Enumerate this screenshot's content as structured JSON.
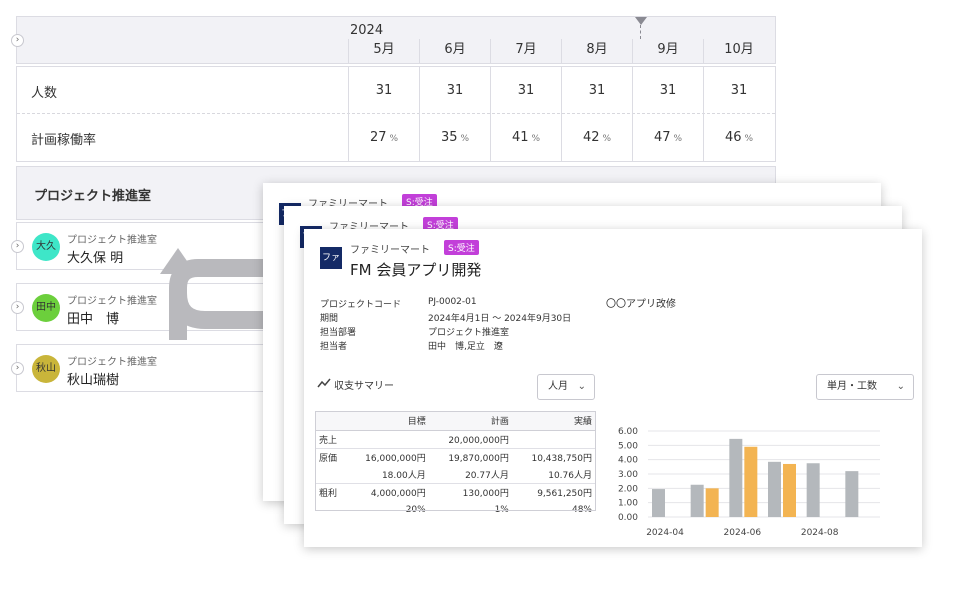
{
  "planner": {
    "year": "2024",
    "months": [
      "5月",
      "6月",
      "7月",
      "8月",
      "9月",
      "10月"
    ],
    "rows": [
      {
        "label": "人数",
        "values": [
          "31",
          "31",
          "31",
          "31",
          "31",
          "31"
        ]
      },
      {
        "label": "計画稼働率",
        "values": [
          "27",
          "35",
          "41",
          "42",
          "47",
          "46"
        ],
        "unit": "%"
      }
    ],
    "department": "プロジェクト推進室",
    "people": [
      {
        "avatar": "大久",
        "dept": "プロジェクト推進室",
        "name": "大久保 明",
        "color": "#3ee6c8"
      },
      {
        "avatar": "田中",
        "dept": "プロジェクト推進室",
        "name": "田中　博",
        "color": "#6ccf3c"
      },
      {
        "avatar": "秋山",
        "dept": "プロジェクト推進室",
        "name": "秋山瑞樹",
        "color": "#c9b53a"
      }
    ]
  },
  "cards": {
    "client": "ファミリーマート",
    "badge": "S:受注",
    "logo": "ファ",
    "title": "FM 会員アプリ開発",
    "info": [
      {
        "label": "プロジェクトコード",
        "value": "PJ-0002-01"
      },
      {
        "label": "期間",
        "value": "2024年4月1日 〜 2024年9月30日"
      },
      {
        "label": "担当部署",
        "value": "プロジェクト推進室"
      },
      {
        "label": "担当者",
        "value": "田中　博,足立　遼"
      }
    ],
    "description": "〇〇アプリ改修",
    "summary_title": "収支サマリー",
    "unit_select": "人月",
    "mode_select": "単月・工数",
    "table": {
      "headers": [
        "",
        "目標",
        "計画",
        "実績"
      ],
      "rows": [
        [
          "売上",
          "",
          "20,000,000円",
          ""
        ],
        [
          "原価",
          "16,000,000円",
          "19,870,000円",
          "10,438,750円"
        ],
        [
          "",
          "18.00人月",
          "20.77人月",
          "10.76人月"
        ],
        [
          "粗利",
          "4,000,000円",
          "130,000円",
          "9,561,250円"
        ],
        [
          "",
          "20%",
          "1%",
          "48%"
        ]
      ]
    }
  },
  "chart_data": {
    "type": "bar",
    "x_ticks": [
      "2024-04",
      "2024-06",
      "2024-08"
    ],
    "categories": [
      "2024-04",
      "2024-05",
      "2024-06",
      "2024-07",
      "2024-08",
      "2024-09"
    ],
    "series": [
      {
        "values": [
          1.95,
          2.25,
          5.45,
          3.85,
          3.75,
          3.2
        ],
        "color": "#b4b8bc"
      },
      {
        "values": [
          null,
          2.0,
          4.9,
          3.7,
          null,
          null
        ],
        "color": "#f3b452"
      }
    ],
    "y_ticks": [
      "6.00",
      "5.00",
      "4.00",
      "3.00",
      "2.00",
      "1.00",
      "0.00"
    ],
    "ylim": [
      0,
      6
    ],
    "grid": true
  }
}
